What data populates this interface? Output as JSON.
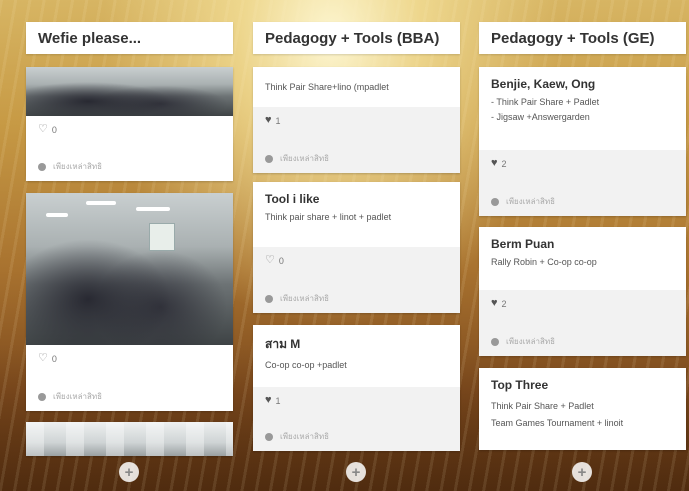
{
  "columns": [
    {
      "title": "Wefie please...",
      "cards": [
        {
          "likes": "0",
          "author": "เพียงเหล่าสิทธิ"
        },
        {
          "likes": "0",
          "author": "เพียงเหล่าสิทธิ"
        }
      ]
    },
    {
      "title": "Pedagogy + Tools (BBA)",
      "cards": [
        {
          "lines": [
            "Think Pair Share+lino (mpadlet"
          ],
          "likes": "1",
          "author": "เพียงเหล่าสิทธิ"
        },
        {
          "title": "Tool i like",
          "lines": [
            "Think pair share + lino​t + padlet"
          ],
          "likes": "0",
          "author": "เพียงเหล่าสิทธิ"
        },
        {
          "title": "สาม M",
          "lines": [
            "Co-op co-op +padlet"
          ],
          "likes": "1",
          "author": "เพียงเหล่าสิทธิ"
        }
      ]
    },
    {
      "title": "Pedagogy + Tools (GE)",
      "cards": [
        {
          "title": "Benjie, Kaew, Ong",
          "lines": [
            "- Think Pair Share + Padlet",
            "- Jigsaw +Answergarden"
          ],
          "likes": "2",
          "author": "เพียงเหล่าสิทธิ"
        },
        {
          "title": "Berm Puan",
          "lines": [
            "Rally Robin + Co-op co-op"
          ],
          "likes": "2",
          "author": "เพียงเหล่าสิทธิ"
        },
        {
          "title": "Top Three",
          "lines": [
            "Think Pair Share + Padlet",
            "Team Games Tournament + linoit"
          ]
        }
      ]
    }
  ],
  "icons": {
    "heart_outline": "heart-outline-icon",
    "heart_solid": "heart-icon",
    "avatar": "avatar-icon",
    "add": "plus-icon"
  },
  "add_symbol": "+"
}
